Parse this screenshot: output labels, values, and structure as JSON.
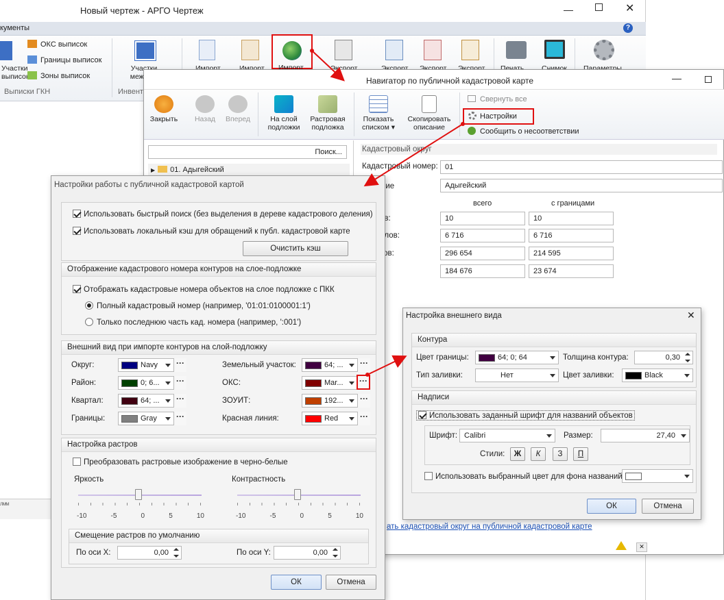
{
  "main": {
    "title": "Новый чертеж - АРГО Чертеж",
    "tab": "кументы",
    "ribbon": {
      "oks": "ОКС выписок",
      "borders": "Границы выписок",
      "zones": "Зоны выписок",
      "parcels_a": "Участки",
      "parcels_b": "выписок",
      "group1": "Выписки ГКН",
      "mezh_a": "Участки",
      "mezh_b": "меж. пл.",
      "group2": "Инвент",
      "imp1": "Импорт",
      "imp2": "Импорт",
      "imp3": "Импорт",
      "exp1": "Экспорт",
      "exp2": "Экспорт",
      "exp3": "Экспорт",
      "exp4": "Экспорт",
      "print": "Печать",
      "snap": "Снимок",
      "params": "Параметры"
    },
    "bottom_text": "лмм"
  },
  "nav": {
    "title": "Навигатор по публичной кадастровой карте",
    "close": "Закрыть",
    "back": "Назад",
    "forward": "Вперед",
    "layer_a": "На слой",
    "layer_b": "подложки",
    "raster_a": "Растровая",
    "raster_b": "подложка",
    "show_a": "Показать",
    "show_b": "списком",
    "copy_a": "Скопировать",
    "copy_b": "описание",
    "collapse": "Свернуть все",
    "settings": "Настройки",
    "report": "Сообщить о несоответствии",
    "search": "Поиск...",
    "tree_item": "01. Адыгейский",
    "section": "Кадастровый округ",
    "cad_label": "Кадастровый номер:",
    "cad_value": "01",
    "name_label": "ние",
    "name_value": "Адыгейский",
    "col_all": "всего",
    "col_bound": "с границами",
    "rows": [
      {
        "label": "ов:",
        "all": "10",
        "bound": "10"
      },
      {
        "label": "алов:",
        "all": "6 716",
        "bound": "6 716"
      },
      {
        "label": "ков:",
        "all": "296 654",
        "bound": "214 595"
      },
      {
        "label": "",
        "all": "184 676",
        "bound": "23 674"
      }
    ],
    "link": "ать кадастровый округ на публичной кадастровой карте"
  },
  "settings": {
    "title": "Настройки работы с публичной кадастровой картой",
    "fast_search": "Использовать быстрый поиск (без выделения в дереве кадастрового деления)",
    "local_cache": "Использовать локальный кэш для обращений к публ. кадастровой карте",
    "clear_cache": "Очистить кэш",
    "grp1": "Отображение кадастрового номера контуров на слое-подложке",
    "show_numbers": "Отображать кадастровые номера объектов на слое подложке с ПКК",
    "full_num": "Полный кадастровый номер (например, '01:01:0100001:1')",
    "last_part": "Только последнюю часть кад. номера (например, ':001')",
    "grp2": "Внешний вид при импорте контуров на слой-подложку",
    "left": [
      {
        "label": "Округ:",
        "value": "Navy",
        "color": "#000080"
      },
      {
        "label": "Район:",
        "value": "0; 6...",
        "color": "#004000"
      },
      {
        "label": "Квартал:",
        "value": "64; ...",
        "color": "#400010"
      },
      {
        "label": "Границы:",
        "value": "Gray",
        "color": "#808080"
      }
    ],
    "right": [
      {
        "label": "Земельный участок:",
        "value": "64; ...",
        "color": "#400040"
      },
      {
        "label": "ОКС:",
        "value": "Mar...",
        "color": "#800000"
      },
      {
        "label": "ЗОУИТ:",
        "value": "192...",
        "color": "#c04000"
      },
      {
        "label": "Красная линия:",
        "value": "Red",
        "color": "#ff0000"
      }
    ],
    "grp3": "Настройка растров",
    "bw": "Преобразовать растровые изображение в черно-белые",
    "brightness": "Яркость",
    "contrast": "Контрастность",
    "ticks": [
      "-10",
      "-5",
      "0",
      "5",
      "10"
    ],
    "grp4": "Смещение растров по умолчанию",
    "by_x": "По оси X:",
    "x_val": "0,00",
    "by_y": "По оси Y:",
    "y_val": "0,00",
    "ok": "ОК",
    "cancel": "Отмена"
  },
  "appearance": {
    "title": "Настройка внешнего вида",
    "grp1": "Контура",
    "border_color": "Цвет границы:",
    "border_value": "64; 0; 64",
    "border_swatch": "#400040",
    "thickness": "Толщина контура:",
    "thickness_value": "0,30",
    "fill_type": "Тип заливки:",
    "fill_value": "Нет",
    "fill_color": "Цвет заливки:",
    "fill_color_value": "Black",
    "grp2": "Надписи",
    "use_font": "Использовать заданный шрифт для названий объектов",
    "font_label": "Шрифт:",
    "font_value": "Calibri",
    "size_label": "Размер:",
    "size_value": "27,40",
    "styles_label": "Стили:",
    "style_b": "Ж",
    "style_i": "К",
    "style_s": "З",
    "style_u": "П",
    "use_bg": "Использовать выбранный цвет для фона названий:",
    "ok": "ОК",
    "cancel": "Отмена"
  }
}
